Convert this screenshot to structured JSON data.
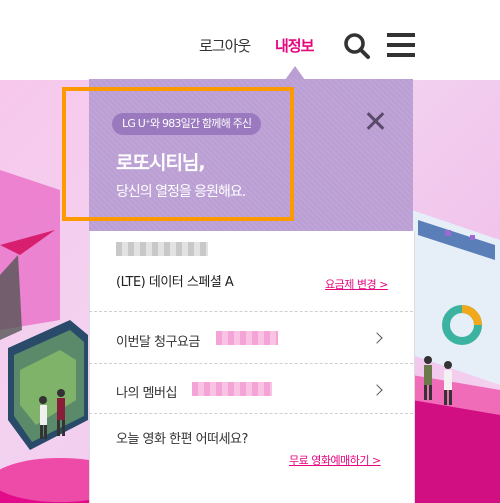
{
  "header": {
    "logout_label": "로그아웃",
    "myinfo_label": "내정보",
    "search_icon": "search-icon",
    "menu_icon": "hamburger-menu-icon"
  },
  "popup": {
    "since_badge": "LG U⁺와 983일간 함께해 주신",
    "user_name": "로또시티님,",
    "cheer_message": "당신의 열정을 응원해요.",
    "close_icon": "close-icon",
    "plan": {
      "name": "(LTE) 데이터 스페셜 A",
      "change_link": "요금제 변경 >"
    },
    "rows": [
      {
        "label": "이번달 청구요금"
      },
      {
        "label": "나의 멤버십"
      }
    ],
    "movie": {
      "question": "오늘 영화 한편 어떠세요?",
      "link": "무료 영화예매하기 >"
    }
  },
  "colors": {
    "accent_pink": "#e5067e",
    "popup_purple": "#bb9fd4",
    "badge_purple": "#9b79bf",
    "highlight_orange": "#ff9900"
  }
}
